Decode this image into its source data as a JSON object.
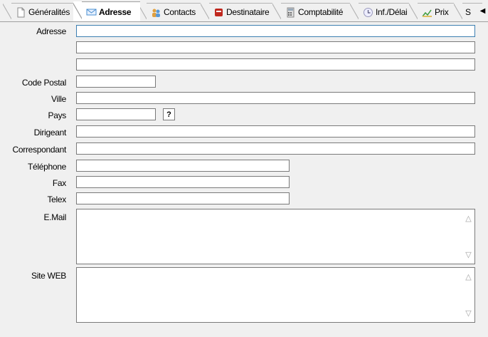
{
  "tabs": [
    {
      "label": "Généralités",
      "icon": "document-icon"
    },
    {
      "label": "Adresse",
      "icon": "envelope-icon",
      "active": true
    },
    {
      "label": "Contacts",
      "icon": "people-icon"
    },
    {
      "label": "Destinataire",
      "icon": "book-icon"
    },
    {
      "label": "Comptabilité",
      "icon": "calculator-icon"
    },
    {
      "label": "Inf./Délai",
      "icon": "clock-icon"
    },
    {
      "label": "Prix",
      "icon": "chart-icon"
    },
    {
      "label": "S",
      "icon": ""
    }
  ],
  "tab_scroll": "◀",
  "form": {
    "adresse_label": "Adresse",
    "code_postal_label": "Code Postal",
    "ville_label": "Ville",
    "pays_label": "Pays",
    "pays_lookup": "?",
    "dirigeant_label": "Dirigeant",
    "correspondant_label": "Correspondant",
    "telephone_label": "Téléphone",
    "fax_label": "Fax",
    "telex_label": "Telex",
    "email_label": "E.Mail",
    "site_label": "Site WEB",
    "adresse1": "",
    "adresse2": "",
    "adresse3": "",
    "code_postal": "",
    "ville": "",
    "pays": "",
    "dirigeant": "",
    "correspondant": "",
    "telephone": "",
    "fax": "",
    "telex": "",
    "email": "",
    "site": ""
  },
  "colors": {
    "focus_border": "#3c7fb1",
    "field_border": "#7a7a7a",
    "background": "#f0f0f0"
  }
}
